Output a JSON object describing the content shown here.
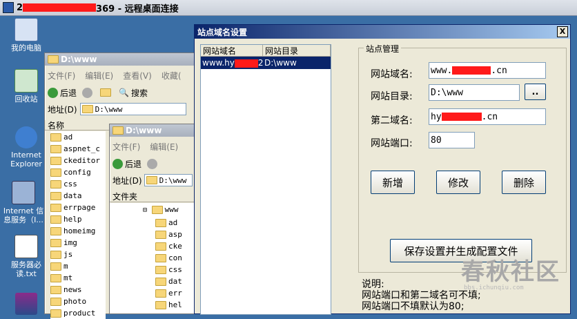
{
  "rdp": {
    "title_prefix": "2",
    "title_suffix": "369 - 远程桌面连接"
  },
  "desktop": {
    "icons": [
      {
        "label": "我的电脑"
      },
      {
        "label": "回收站"
      },
      {
        "label": "Internet Explorer"
      },
      {
        "label": "Internet 信息服务（I..."
      },
      {
        "label": "服务器必读.txt"
      },
      {
        "label": ""
      }
    ]
  },
  "explorer1": {
    "title": "D:\\www",
    "menu": [
      "文件(F)",
      "编辑(E)",
      "查看(V)",
      "收藏("
    ],
    "back_label": "后退",
    "search_label": "搜索",
    "address_label": "地址(D)",
    "address_value": "D:\\www",
    "name_col": "名称",
    "files": [
      "ad",
      "aspnet_c",
      "ckeditor",
      "config",
      "css",
      "data",
      "errpage",
      "help",
      "homeimg",
      "img",
      "js",
      "m",
      "mt",
      "news",
      "photo",
      "product"
    ]
  },
  "explorer2": {
    "title": "D:\\www",
    "menu": [
      "文件(F)",
      "编辑(E)"
    ],
    "back_label": "后退",
    "address_label": "地址(D)",
    "address_value": "D:\\www",
    "folders_label": "文件夹",
    "tree_root": "www",
    "tree_items": [
      "ad",
      "asp",
      "cke",
      "con",
      "css",
      "dat",
      "err",
      "hel"
    ]
  },
  "dialog": {
    "title": "站点域名设置",
    "close": "X",
    "list_headers": [
      "网站域名",
      "网站目录"
    ],
    "list_row": {
      "domain": "www.hy",
      "domain_suffix": "2",
      "dir": "D:\\www"
    },
    "group_label": "站点管理",
    "fields": {
      "domain_label": "网站域名:",
      "domain_value_prefix": "www.",
      "domain_value_suffix": ".cn",
      "dir_label": "网站目录:",
      "dir_value": "D:\\www",
      "browse_label": "..",
      "second_label": "第二域名:",
      "second_prefix": "hy",
      "second_suffix": ".cn",
      "port_label": "网站端口:",
      "port_value": "80"
    },
    "buttons": {
      "add": "新增",
      "edit": "修改",
      "delete": "删除",
      "save": "保存设置并生成配置文件"
    },
    "notes": [
      "说明:",
      "网站端口和第二域名可不填;",
      "网站端口不填默认为80;"
    ]
  },
  "watermark": {
    "text": "春秋社区",
    "url": "bbs.ichunqiu.com"
  },
  "colors": {
    "selection": "#0a246a",
    "redact": "#ff1a1a",
    "desktop": "#3a6ea5"
  }
}
